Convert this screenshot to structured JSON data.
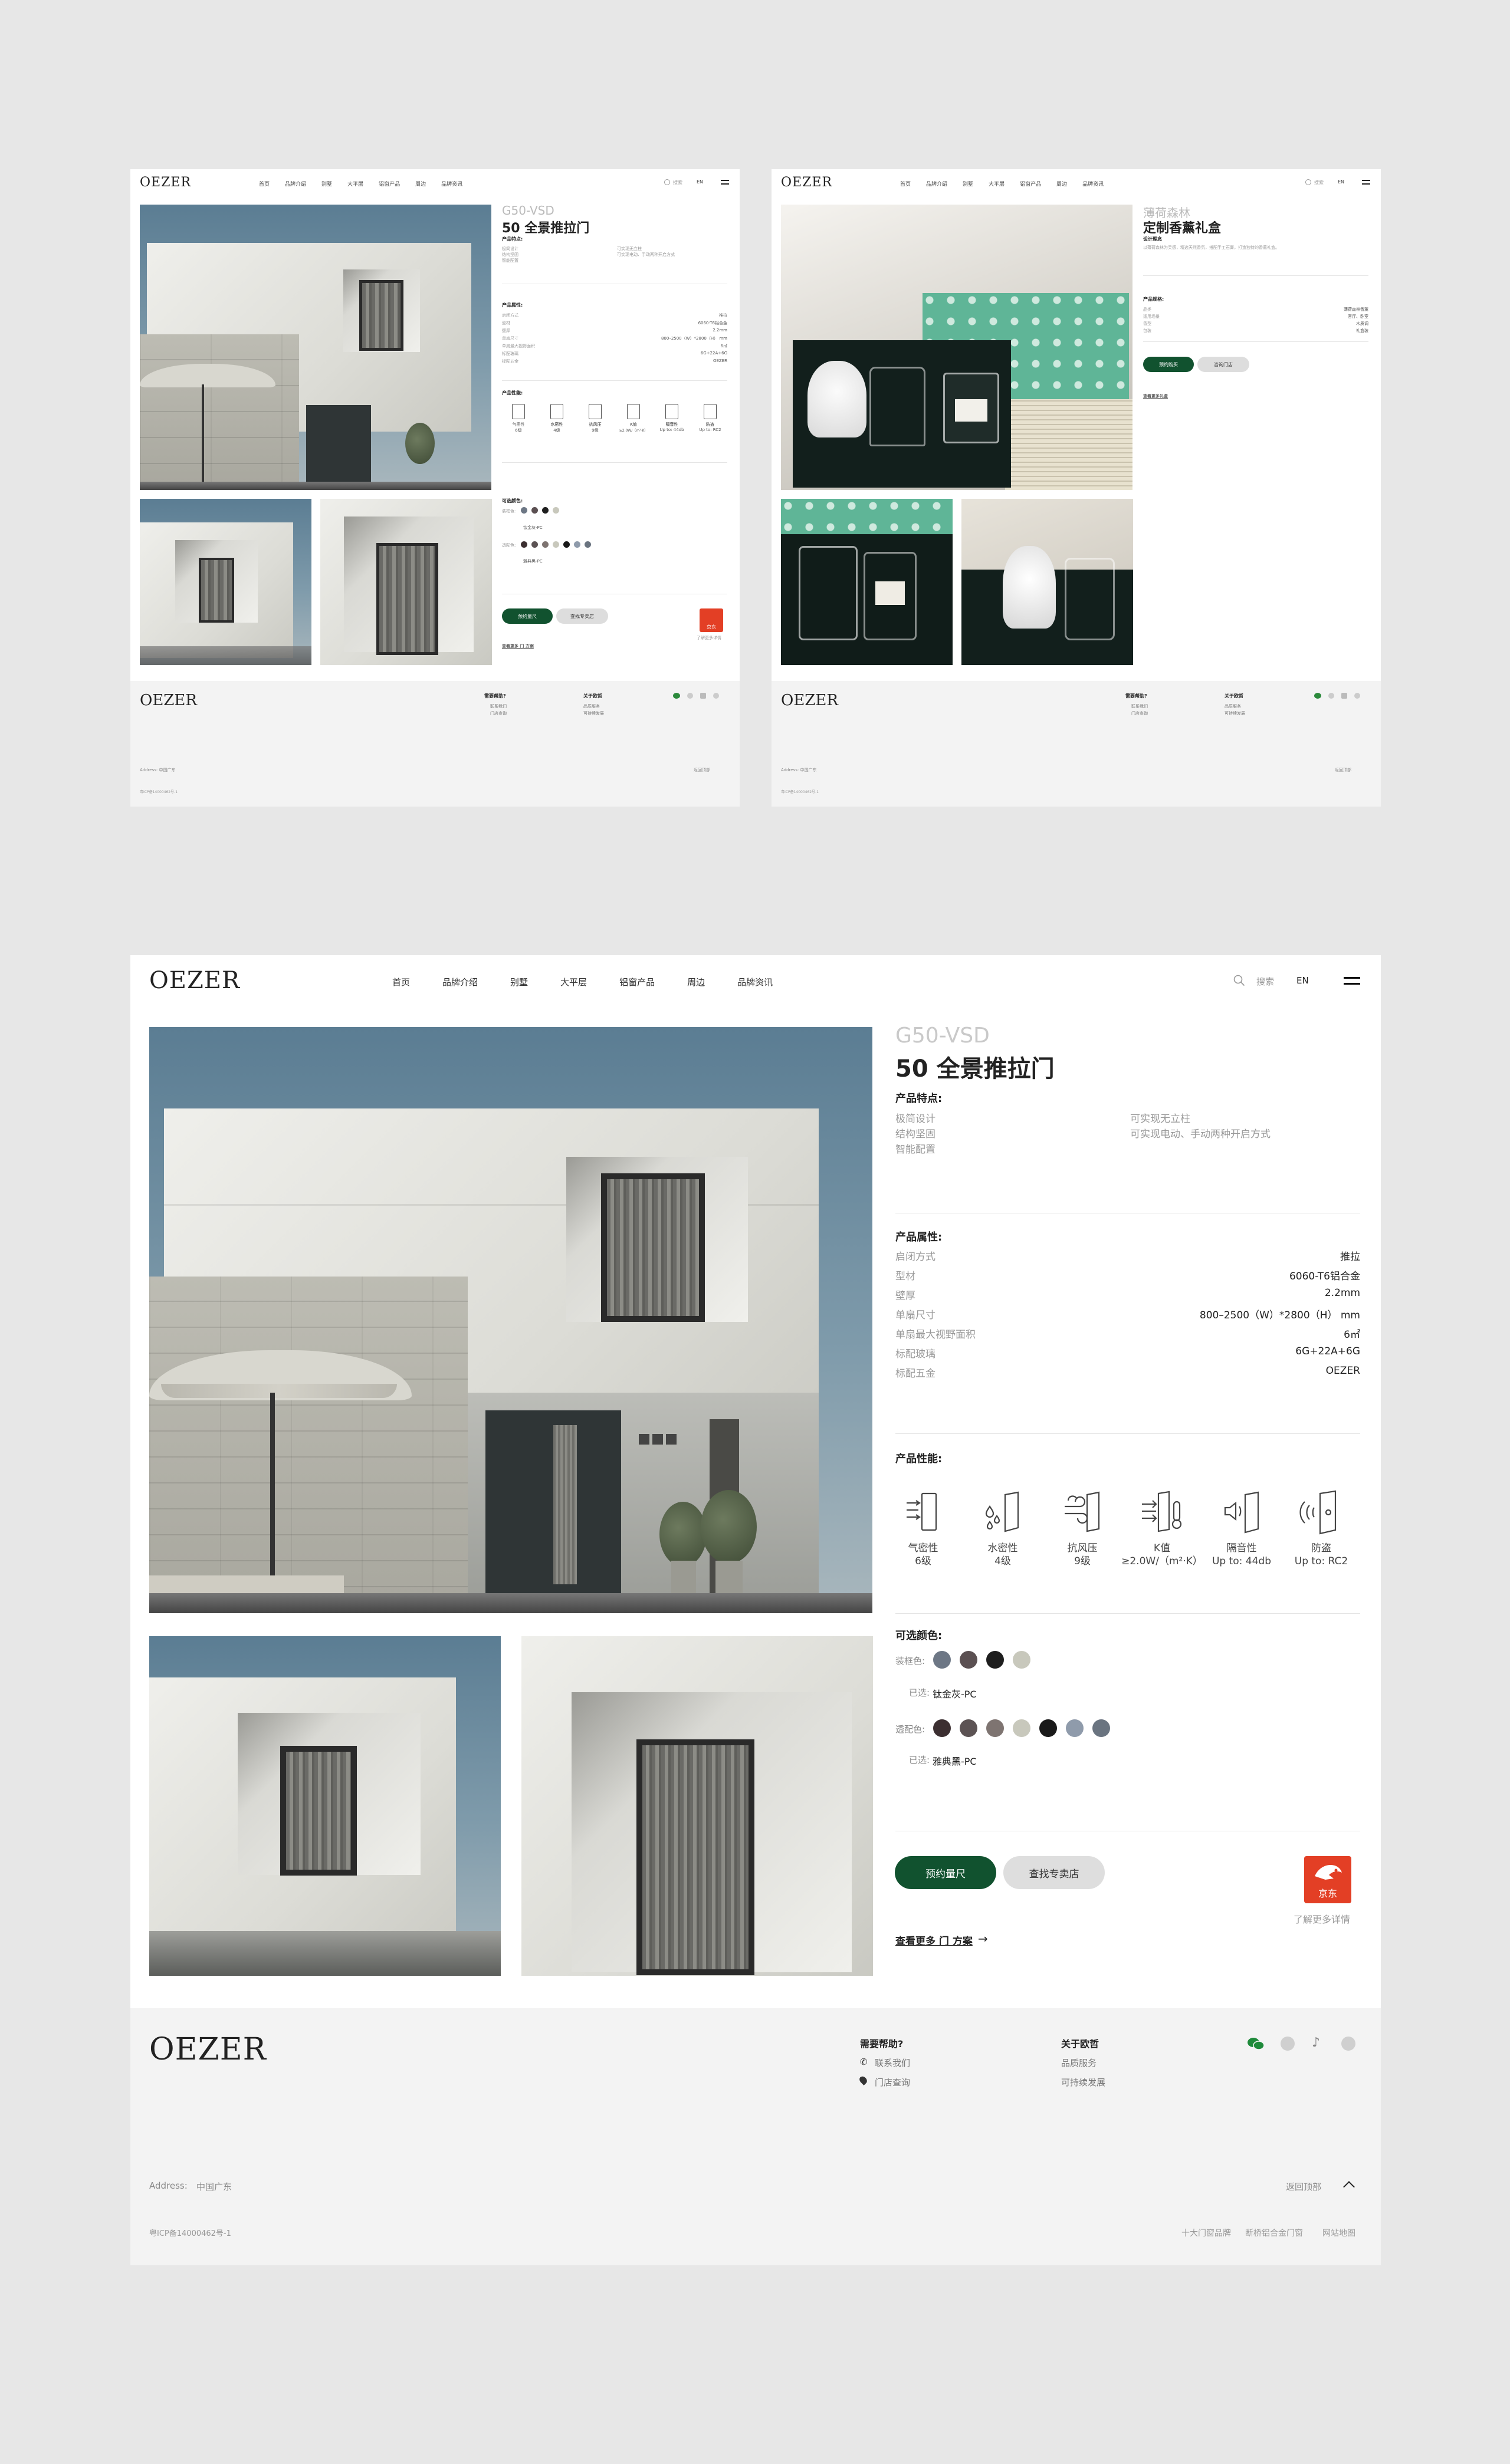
{
  "brand": "OEZER",
  "nav": [
    "首页",
    "品牌介绍",
    "别墅",
    "大平层",
    "铝窗产品",
    "周边",
    "品牌资讯"
  ],
  "search_label": "搜索",
  "lang": "EN",
  "product": {
    "code": "G50-VSD",
    "title": "50 全景推拉门",
    "features_title": "产品特点:",
    "features_left": [
      "极简设计",
      "结构坚固",
      "智能配置"
    ],
    "features_right": [
      "可实现无立柱",
      "可实现电动、手动两种开启方式"
    ],
    "attrs_title": "产品属性:",
    "attrs": [
      {
        "k": "启闭方式",
        "v": "推拉"
      },
      {
        "k": "型材",
        "v": "6060-T6铝合金"
      },
      {
        "k": "壁厚",
        "v": "2.2mm"
      },
      {
        "k": "单扇尺寸",
        "v": "800–2500（W）*2800（H） mm"
      },
      {
        "k": "单扇最大视野面积",
        "v": "6㎡"
      },
      {
        "k": "标配玻璃",
        "v": "6G+22A+6G"
      },
      {
        "k": "标配五金",
        "v": "OEZER"
      }
    ],
    "perf_title": "产品性能:",
    "perf": [
      {
        "name": "气密性",
        "level": "6级",
        "icon": "airtight-icon"
      },
      {
        "name": "水密性",
        "level": "4级",
        "icon": "watertight-icon"
      },
      {
        "name": "抗风压",
        "level": "9级",
        "icon": "wind-pressure-icon"
      },
      {
        "name": "K值",
        "level": "≥2.0W/（m²·K）",
        "icon": "thermal-icon"
      },
      {
        "name": "隔音性",
        "level": "Up to: 44db",
        "icon": "soundproof-icon"
      },
      {
        "name": "防盗",
        "level": "Up to: RC2",
        "icon": "anti-theft-icon"
      }
    ],
    "colors_title": "可选颜色:",
    "color_group1": {
      "label": "装框色:",
      "selected_prefix": "已选:",
      "selected": "钛金灰-PC",
      "swatches": [
        "#6d7785",
        "#5b5052",
        "#1e1e1e",
        "#c8c8bc"
      ]
    },
    "color_group2": {
      "label": "透配色:",
      "selected_prefix": "已选:",
      "selected": "雅典黑-PC",
      "swatches": [
        "#3c2f31",
        "#5c5354",
        "#7e7471",
        "#c8c8bc",
        "#1a1a1a",
        "#8f9bab",
        "#6a7480"
      ]
    },
    "btn_measure": "预约量尺",
    "btn_store": "查找专卖店",
    "more_link": "查看更多 门 方案",
    "jd_label": "京东",
    "jd_more": "了解更多详情"
  },
  "footer": {
    "help_title": "需要帮助?",
    "help_items": [
      "联系我们",
      "门店查询"
    ],
    "about_title": "关于欧哲",
    "about_items": [
      "品质服务",
      "可持续发展"
    ],
    "address_label": "Address:",
    "address": "中国广东",
    "back_top": "返回顶部",
    "icp": "粤ICP备14000462号-1",
    "links": [
      "十大门窗品牌",
      "断桥铝合金门窗",
      "网站地图"
    ]
  },
  "gift": {
    "brand_en": "薄荷森林",
    "title": "定制香薰礼盒",
    "sub": "设计理念",
    "desc": "以薄荷森林为灵感，精选天然香氛，搭配手工石膏，打造独特的香薰礼盒。",
    "attrs_title": "产品规格:",
    "attrs": [
      {
        "k": "品类",
        "v": "薄荷森林香薰"
      },
      {
        "k": "适用场景",
        "v": "客厅、卧室"
      },
      {
        "k": "香型",
        "v": "木质调"
      },
      {
        "k": "包装",
        "v": "礼盒装"
      }
    ],
    "btn1": "预约购买",
    "btn2": "咨询门店",
    "more": "查看更多礼盒"
  }
}
